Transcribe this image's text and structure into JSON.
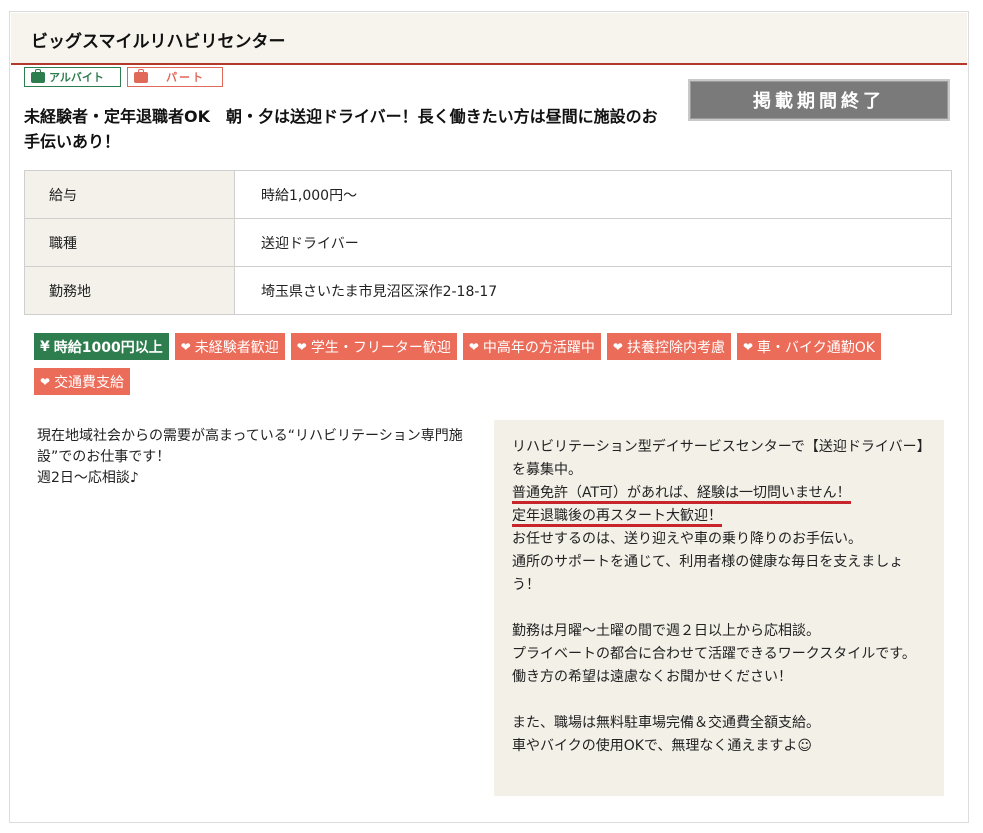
{
  "header": {
    "company": "ビッグスマイルリハビリセンター"
  },
  "badges": {
    "arubaito": "アルバイト",
    "part": "パート"
  },
  "status_button": "掲載期間終了",
  "job_title": "未経験者・定年退職者OK　朝・夕は送迎ドライバー！長く働きたい方は昼間に施設のお手伝いあり！",
  "info_table": [
    {
      "label": "給与",
      "value": "時給1,000円～"
    },
    {
      "label": "職種",
      "value": "送迎ドライバー"
    },
    {
      "label": "勤務地",
      "value": "埼玉県さいたま市見沼区深作2-18-17"
    }
  ],
  "tags": {
    "wage": "時給1000円以上",
    "items": [
      "未経験者歓迎",
      "学生・フリーター歓迎",
      "中高年の方活躍中",
      "扶養控除内考慮",
      "車・バイク通勤OK",
      "交通費支給"
    ]
  },
  "lead_text": {
    "line1": "現在地域社会からの需要が高まっている“リハビリテーション専門施設”でのお仕事です！",
    "line2": "週2日～応相談♪"
  },
  "description": {
    "p1": "リハビリテーション型デイサービスセンターで【送迎ドライバー】を募集中。",
    "u1": "普通免許（AT可）があれば、経験は一切問いません！",
    "u2": "定年退職後の再スタート大歓迎！",
    "p2": "お任せするのは、送り迎えや車の乗り降りのお手伝い。",
    "p3": "通所のサポートを通じて、利用者様の健康な毎日を支えましょう！",
    "p4": "勤務は月曜～土曜の間で週２日以上から応相談。",
    "p5": "プライベートの都合に合わせて活躍できるワークスタイルです。",
    "p6": "働き方の希望は遠慮なくお聞かせください！",
    "p7": "また、職場は無料駐車場完備＆交通費全額支給。",
    "p8": "車やバイクの使用OKで、無理なく通えますよ☺"
  },
  "colors": {
    "accent_red": "#b33a2a",
    "green": "#2e7d4f",
    "tag_red": "#ec6c5a",
    "underline": "#c8242b"
  }
}
